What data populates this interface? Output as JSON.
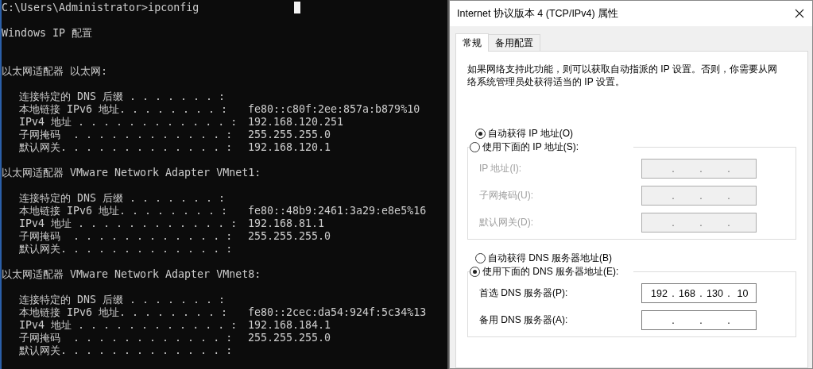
{
  "terminal": {
    "command_line": "C:\\Users\\Administrator>ipconfig",
    "header": "Windows IP 配置",
    "adapters": [
      {
        "heading": "以太网适配器 以太网:",
        "entries": [
          {
            "label": "连接特定的 DNS 后缀 . . . . . . . :"
          },
          {
            "label": "本地链接 IPv6 地址. . . . . . . . :",
            "value": "fe80::c80f:2ee:857a:b879%10"
          },
          {
            "label": "IPv4 地址 . . . . . . . . . . . . :",
            "value": "192.168.120.251"
          },
          {
            "label": "子网掩码  . . . . . . . . . . . . :",
            "value": "255.255.255.0"
          },
          {
            "label": "默认网关. . . . . . . . . . . . . :",
            "value": "192.168.120.1"
          }
        ]
      },
      {
        "heading": "以太网适配器 VMware Network Adapter VMnet1:",
        "entries": [
          {
            "label": "连接特定的 DNS 后缀 . . . . . . . :"
          },
          {
            "label": "本地链接 IPv6 地址. . . . . . . . :",
            "value": "fe80::48b9:2461:3a29:e8e5%16"
          },
          {
            "label": "IPv4 地址 . . . . . . . . . . . . :",
            "value": "192.168.81.1"
          },
          {
            "label": "子网掩码  . . . . . . . . . . . . :",
            "value": "255.255.255.0"
          },
          {
            "label": "默认网关. . . . . . . . . . . . . :"
          }
        ]
      },
      {
        "heading": "以太网适配器 VMware Network Adapter VMnet8:",
        "entries": [
          {
            "label": "连接特定的 DNS 后缀 . . . . . . . :"
          },
          {
            "label": "本地链接 IPv6 地址. . . . . . . . :",
            "value": "fe80::2cec:da54:924f:5c34%13"
          },
          {
            "label": "IPv4 地址 . . . . . . . . . . . . :",
            "value": "192.168.184.1"
          },
          {
            "label": "子网掩码  . . . . . . . . . . . . :",
            "value": "255.255.255.0"
          },
          {
            "label": "默认网关. . . . . . . . . . . . . :"
          }
        ]
      }
    ]
  },
  "dialog": {
    "title": "Internet 协议版本 4 (TCP/IPv4) 属性",
    "tabs": [
      {
        "label": "常规",
        "selected": true
      },
      {
        "label": "备用配置",
        "selected": false
      }
    ],
    "description": "如果网络支持此功能，则可以获取自动指派的 IP 设置。否则，你需要从网络系统管理员处获得适当的 IP 设置。",
    "ip": {
      "auto_option": {
        "label": "自动获得 IP 地址(O)",
        "selected": true
      },
      "manual_option": {
        "label": "使用下面的 IP 地址(S):",
        "selected": false
      },
      "fields": [
        {
          "label": "IP 地址(I):",
          "disabled": true,
          "dots": [
            ".",
            ".",
            "."
          ]
        },
        {
          "label": "子网掩码(U):",
          "disabled": true,
          "dots": [
            ".",
            ".",
            "."
          ]
        },
        {
          "label": "默认网关(D):",
          "disabled": true,
          "dots": [
            ".",
            ".",
            "."
          ]
        }
      ]
    },
    "dns": {
      "auto_option": {
        "label": "自动获得 DNS 服务器地址(B)",
        "selected": false
      },
      "manual_option": {
        "label": "使用下面的 DNS 服务器地址(E):",
        "selected": true
      },
      "fields": [
        {
          "label": "首选 DNS 服务器(P):",
          "disabled": false,
          "octets": [
            "192",
            "168",
            "130",
            "10"
          ],
          "dots": [
            ".",
            ".",
            "."
          ]
        },
        {
          "label": "备用 DNS 服务器(A):",
          "disabled": false,
          "dots": [
            ".",
            ".",
            "."
          ]
        }
      ]
    }
  }
}
